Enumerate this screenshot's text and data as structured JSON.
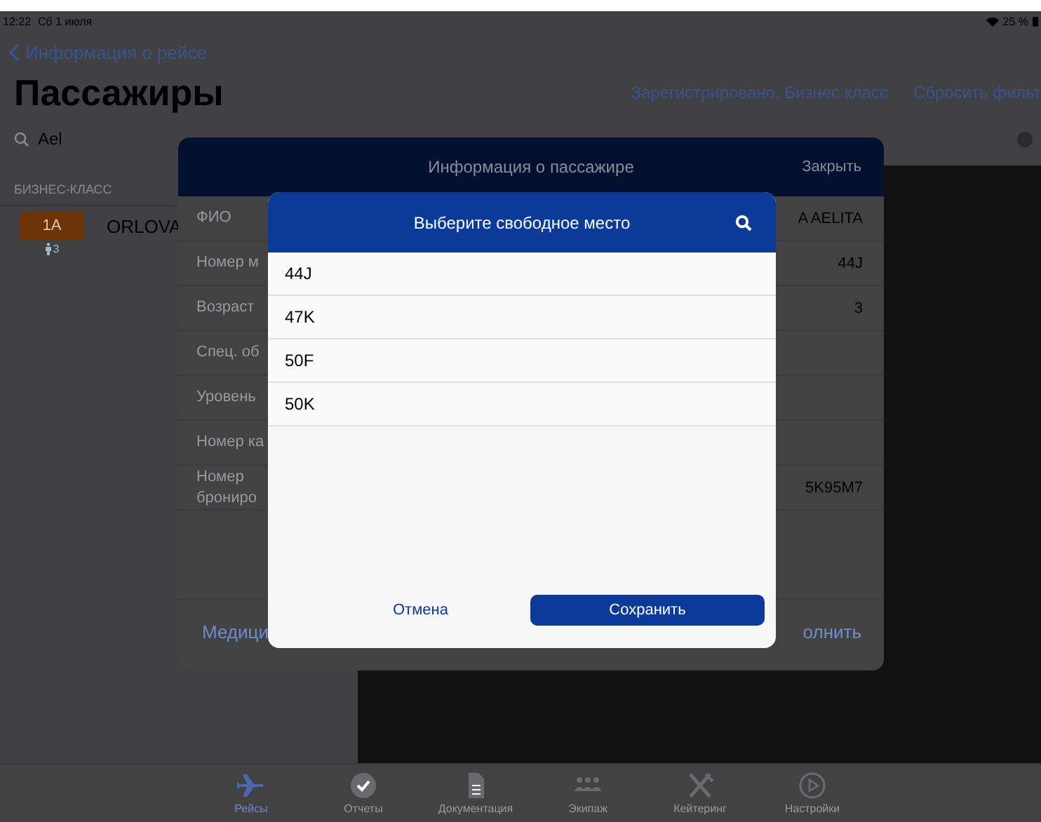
{
  "status_bar": {
    "time": "12:22",
    "date": "Сб 1 июля",
    "battery": "25 %"
  },
  "nav": {
    "back": "Информация о рейсе",
    "title": "Пассажиры",
    "filter": "Зарегистрировано, Бизнес класс",
    "reset": "Сбросить фильт"
  },
  "search": {
    "value": "Ael"
  },
  "sections": [
    {
      "title": "БИЗНЕС-КЛАСС",
      "passengers": [
        {
          "seat": "1A",
          "name": "ORLOVA",
          "count": "3"
        }
      ]
    }
  ],
  "passenger_card": {
    "title": "Информация о пассажире",
    "close": "Закрыть",
    "rows": [
      {
        "label": "ФИО",
        "value": "A AELITA"
      },
      {
        "label": "Номер м",
        "value": "44J"
      },
      {
        "label": "Возраст",
        "value": "3"
      },
      {
        "label": "Спец. об",
        "value": ""
      },
      {
        "label": "Уровень",
        "value": ""
      },
      {
        "label": "Номер ка",
        "value": ""
      },
      {
        "label": "Номер\nброниро",
        "value": "5K95M7"
      }
    ],
    "footer_left": "Медици",
    "footer_right": "олнить"
  },
  "seat_picker": {
    "title": "Выберите свободное место",
    "seats": [
      "44J",
      "47K",
      "50F",
      "50K"
    ],
    "cancel": "Отмена",
    "save": "Сохранить"
  },
  "tab_bar": [
    {
      "kind": "plane",
      "label": "Рейсы",
      "selected": true
    },
    {
      "kind": "check",
      "label": "Отчеты",
      "selected": false
    },
    {
      "kind": "document",
      "label": "Документация",
      "selected": false
    },
    {
      "kind": "people",
      "label": "Экипаж",
      "selected": false
    },
    {
      "kind": "food",
      "label": "Кейтеринг",
      "selected": false
    },
    {
      "kind": "play",
      "label": "Настройки",
      "selected": false
    }
  ]
}
